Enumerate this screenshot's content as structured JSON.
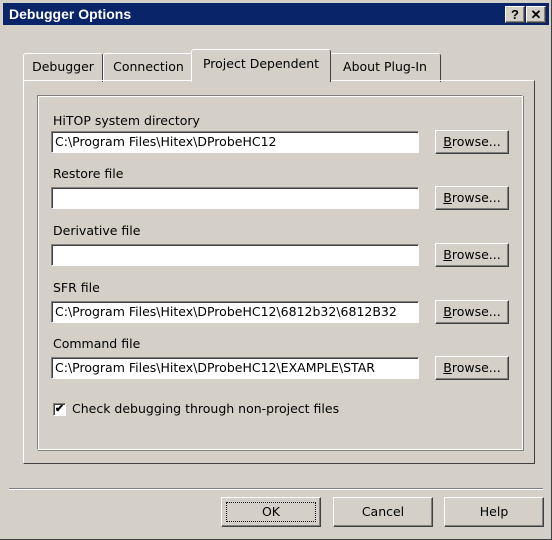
{
  "window": {
    "title": "Debugger Options",
    "help_glyph": "?",
    "close_glyph": "✕"
  },
  "tabs": [
    {
      "label": "Debugger"
    },
    {
      "label": "Connection"
    },
    {
      "label": "Project Dependent",
      "active": true
    },
    {
      "label": "About Plug-In"
    }
  ],
  "fields": [
    {
      "label": "HiTOP system directory",
      "value": "C:\\Program Files\\Hitex\\DProbeHC12"
    },
    {
      "label": "Restore file",
      "value": ""
    },
    {
      "label": "Derivative file",
      "value": ""
    },
    {
      "label": "SFR file",
      "value": "C:\\Program Files\\Hitex\\DProbeHC12\\6812b32\\6812B32"
    },
    {
      "label": "Command file",
      "value": "C:\\Program Files\\Hitex\\DProbeHC12\\EXAMPLE\\STAR"
    }
  ],
  "browse": {
    "mnemonic": "B",
    "rest": "rowse..."
  },
  "checkbox": {
    "label": "Check debugging through non-project files",
    "checked": true,
    "mark": "✔"
  },
  "buttons": {
    "ok": "OK",
    "cancel": "Cancel",
    "help": "Help"
  }
}
